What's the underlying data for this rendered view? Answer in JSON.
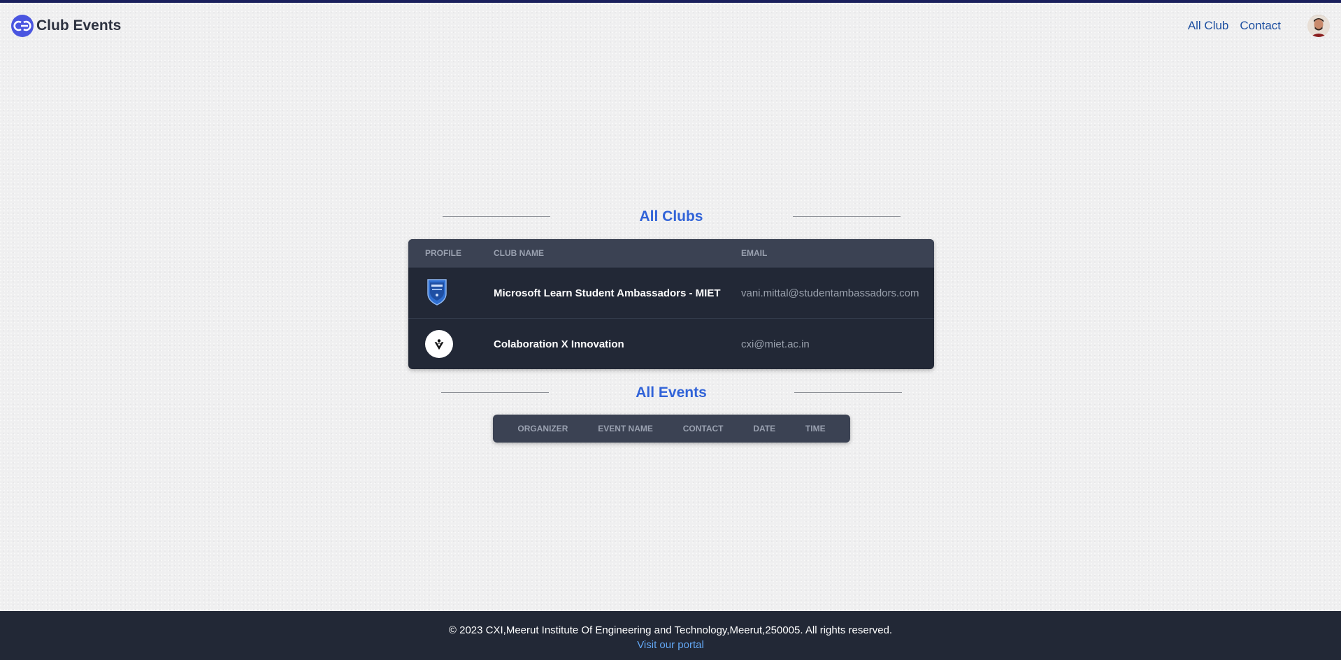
{
  "brand": {
    "name": "Club Events",
    "logo_icon": "cxi-logo-icon"
  },
  "nav": {
    "links": [
      "All Club",
      "Contact"
    ],
    "avatar_icon": "user-avatar-icon"
  },
  "clubs_section": {
    "title": "All Clubs",
    "columns": [
      "Profile",
      "Club Name",
      "Email"
    ],
    "rows": [
      {
        "profile_icon": "mlsa-badge-icon",
        "name": "Microsoft Learn Student Ambassadors - MIET",
        "email": "vani.mittal@studentambassadors.com"
      },
      {
        "profile_icon": "cxi-club-logo-icon",
        "name": "Colaboration X Innovation",
        "email": "cxi@miet.ac.in"
      }
    ]
  },
  "events_section": {
    "title": "All Events",
    "columns": [
      "Organizer",
      "Event Name",
      "Contact",
      "Date",
      "Time"
    ]
  },
  "footer": {
    "copyright": "© 2023 CXI,Meerut Institute Of Engineering and Technology,Meerut,250005. All rights reserved.",
    "link_label": "Visit our portal"
  },
  "colors": {
    "accent": "#3163d8",
    "nav_link": "#1d4fa0",
    "table_bg": "#222836",
    "table_head": "#3b4253",
    "footer_bg": "#222836"
  }
}
